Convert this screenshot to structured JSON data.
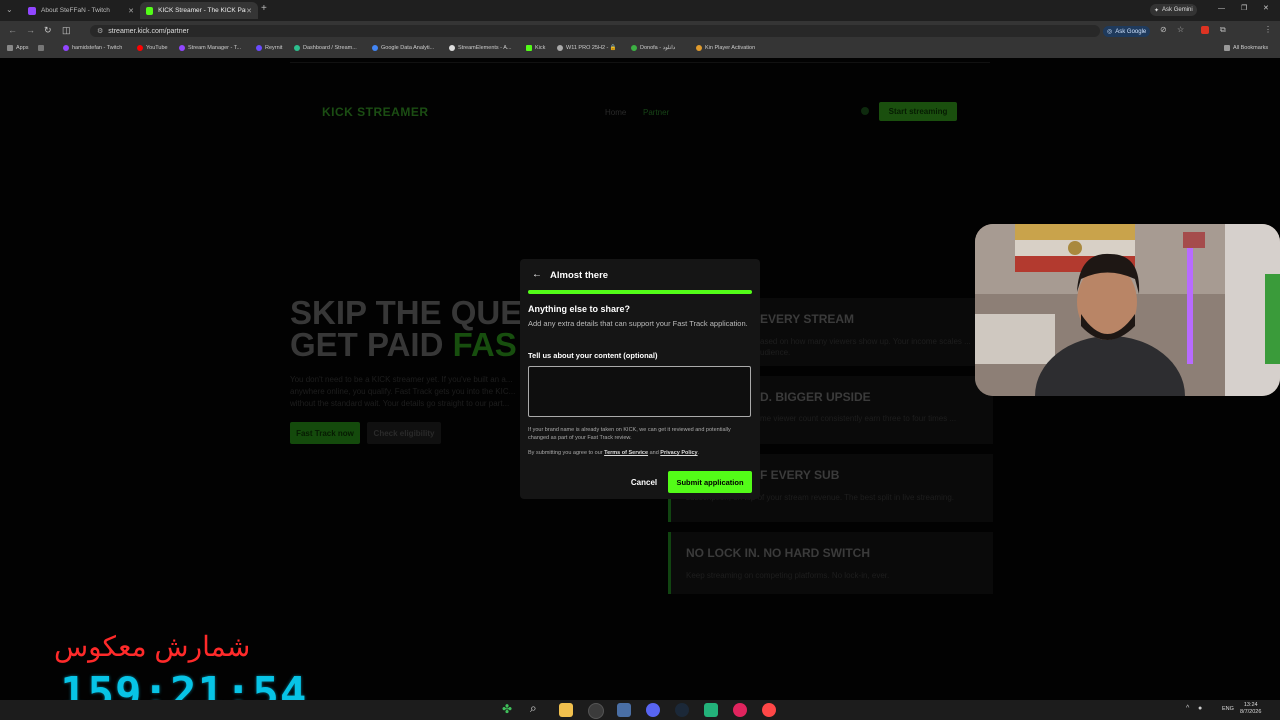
{
  "browser": {
    "tabs": [
      {
        "title": "About SteFFaN - Twitch",
        "icon_color": "#9146ff"
      },
      {
        "title": "KICK Streamer - The KICK Partn…",
        "icon_color": "#53fc18"
      }
    ],
    "url": "streamer.kick.com/partner",
    "ask_gemini": "Ask Gemini",
    "ask_google": "Ask Google",
    "all_bookmarks": "All Bookmarks",
    "bookmarks": [
      "Apps",
      "hamidstefan - Twitch",
      "YouTube",
      "Stream Manager - T...",
      "Reyrnit",
      "Dashboard / Stream...",
      "Google Data Analyti...",
      "StreamElements - A...",
      "Kick",
      "W11 PRO 25H2 - 🔒",
      "Donofa - دانلود",
      "Kin Player Activation"
    ]
  },
  "site": {
    "logo": "KICK STREAMER",
    "nav": [
      "Home",
      "Partner"
    ],
    "cta": "Start streaming",
    "hero_line1": "SKIP THE QUE",
    "hero_line2": "GET PAID ",
    "hero_line2_accent": "FAS",
    "hero_text": "You don't need to be a KICK streamer yet. If you've built an a... anywhere online, you qualify. Fast Track gets you into the KIC... without the standard wait. Your details go straight to our part...",
    "buttons": [
      "Fast Track now",
      "Check eligibility"
    ],
    "cards": [
      {
        "title": "EVERY STREAM",
        "text": "ased on how many viewers show up. Your income scales ... udience."
      },
      {
        "title": "D. BIGGER UPSIDE",
        "text": "me viewer count consistently earn three to four times ..."
      },
      {
        "title": "F EVERY SUB",
        "text": "subscription, on top of your stream revenue. The best split in live streaming."
      },
      {
        "title": "NO LOCK IN. NO HARD SWITCH",
        "text": "Keep streaming on competing platforms. No lock-in, ever."
      }
    ]
  },
  "modal": {
    "title": "Almost there",
    "progress": 1.0,
    "question": "Anything else to share?",
    "description": "Add any extra details that can support your Fast Track application.",
    "field_label": "Tell us about your content (optional)",
    "field_value": "",
    "note": "If your brand name is already taken on KICK, we can get it reviewed and potentially changed as part of your Fast Track review.",
    "terms_prefix": "By submitting you agree to our ",
    "terms_link": "Terms of Service",
    "terms_and": " and ",
    "privacy_link": "Privacy Policy",
    "terms_suffix": ".",
    "cancel": "Cancel",
    "submit": "Submit application"
  },
  "overlay": {
    "countdown_label": "شمارش معکوس",
    "countdown_value": "159:21:54"
  },
  "taskbar": {
    "lang": "ENG",
    "time": "13:24",
    "date": "8/7/2026"
  },
  "colors": {
    "accent": "#53fc18",
    "countdown": "#07c4e6",
    "countdown_label": "#ff2a2a"
  }
}
